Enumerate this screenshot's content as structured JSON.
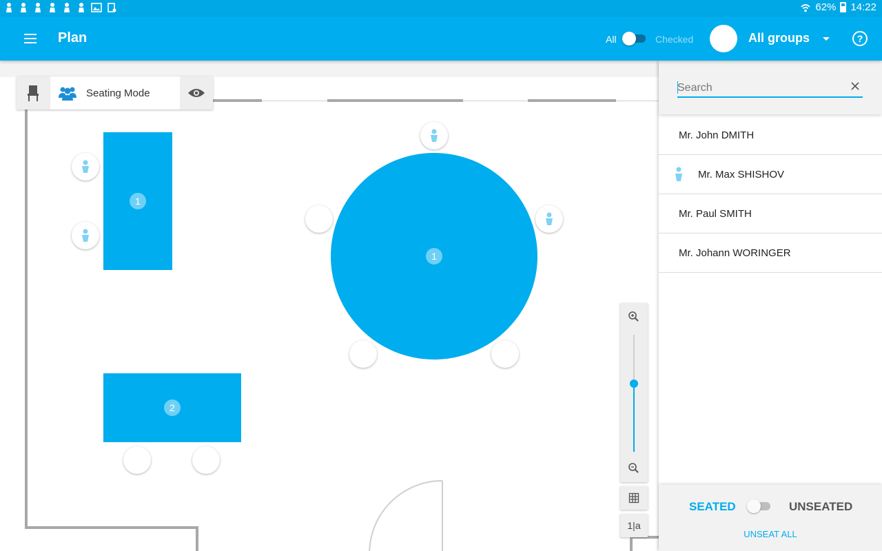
{
  "status_bar": {
    "wifi_icon": "wifi-icon",
    "battery": "62%",
    "time": "14:22",
    "notification_icons": [
      "pawn-icon",
      "pawn-icon",
      "pawn-icon",
      "pawn-icon",
      "pawn-icon",
      "pawn-icon",
      "gallery-icon",
      "device-icon"
    ]
  },
  "app_bar": {
    "title": "Plan",
    "filter_all": "All",
    "filter_checked": "Checked",
    "groups_label": "All groups",
    "help_label": "?",
    "accent_color": "#00adee"
  },
  "mode_toolbar": {
    "mode_label": "Seating Mode",
    "chair_icon": "chair-icon",
    "mode_icon": "group-icon",
    "view_icon": "eye-icon"
  },
  "floor_plan": {
    "tables": [
      {
        "id": "rect-table-1",
        "number": "1",
        "shape": "rectangle"
      },
      {
        "id": "round-table-1",
        "number": "1",
        "shape": "round"
      },
      {
        "id": "rect-table-2",
        "number": "2",
        "shape": "rectangle"
      }
    ],
    "table_color": "#00adee"
  },
  "zoom_controls": {
    "zoom_in_icon": "zoom-in-icon",
    "zoom_out_icon": "zoom-out-icon",
    "zoom_level_fraction": 0.58,
    "grid_icon": "grid-icon",
    "numbering_label": "1|a"
  },
  "guest_panel": {
    "search_placeholder": "Search",
    "clear_icon": "close-icon",
    "guests": [
      {
        "name": "Mr. John DMITH",
        "seated": false
      },
      {
        "name": "Mr. Max SHISHOV",
        "seated": true
      },
      {
        "name": "Mr. Paul SMITH",
        "seated": false
      },
      {
        "name": "Mr. Johann WORINGER",
        "seated": false
      }
    ],
    "seated_label": "SEATED",
    "unseated_label": "UNSEATED",
    "unseat_all_label": "UNSEAT ALL"
  }
}
